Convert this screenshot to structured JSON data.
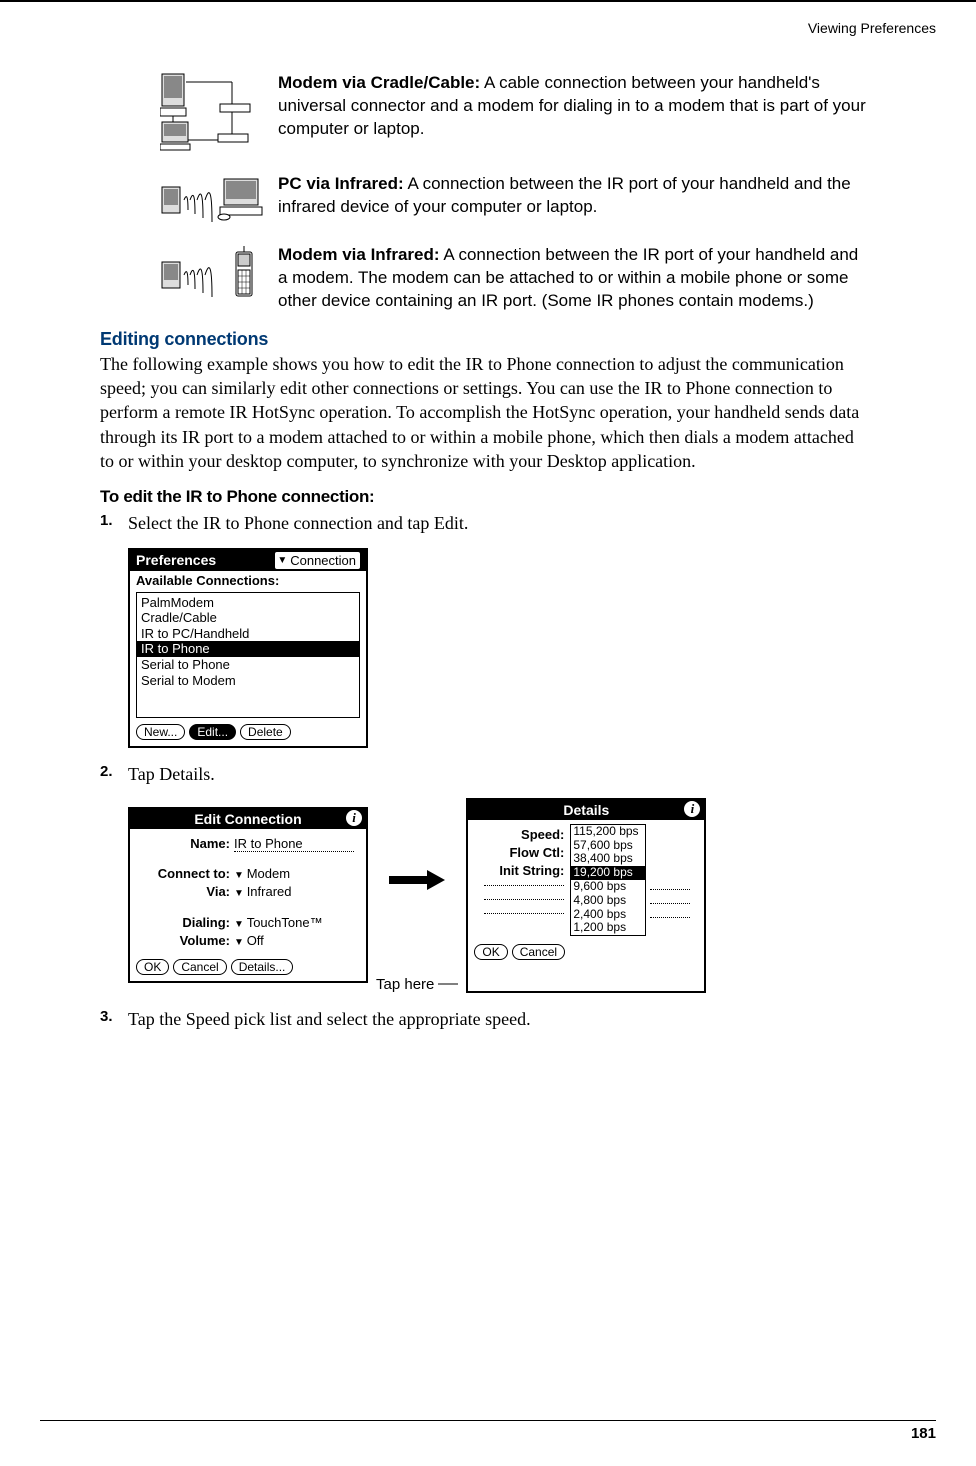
{
  "header": "Viewing Preferences",
  "page_number": "181",
  "defs": [
    {
      "title": " Modem via Cradle/Cable:",
      "text": " A cable connection between your handheld's universal connector and a modem for dialing in to a modem that is part of your computer or laptop."
    },
    {
      "title": "PC via Infrared:",
      "text": " A connection between the IR port of your handheld and the infrared device of your computer or laptop."
    },
    {
      "title": "Modem via Infrared:",
      "text": " A connection between the IR port of your handheld and a modem. The modem can be attached to or within a mobile phone or some other device containing an IR port. (Some IR phones contain modems.)"
    }
  ],
  "editing_heading": "Editing connections",
  "editing_body": "The following example shows you how to edit the IR to Phone connection to adjust the communication speed; you can similarly edit other connections or settings. You can use the IR to Phone connection to perform a remote IR HotSync operation. To accomplish the HotSync operation, your handheld sends data through its IR port to a modem attached to or within a mobile phone, which then dials a modem attached to or within your desktop computer, to synchronize with your Desktop application.",
  "procedure_heading": "To edit the IR to Phone connection:",
  "steps": [
    "Select the IR to Phone connection and tap Edit.",
    "Tap Details.",
    "Tap the Speed pick list and select the appropriate speed."
  ],
  "prefs_screen": {
    "title": "Preferences",
    "menu": "Connection",
    "label": "Available Connections:",
    "items": [
      "PalmModem",
      "Cradle/Cable",
      "IR to PC/Handheld",
      "IR to Phone",
      "Serial to Phone",
      "Serial to Modem"
    ],
    "buttons": [
      "New...",
      "Edit...",
      "Delete"
    ]
  },
  "edit_screen": {
    "title": "Edit Connection",
    "name_label": "Name:",
    "name_value": "IR to Phone",
    "connect_label": "Connect to:",
    "connect_value": "Modem",
    "via_label": "Via:",
    "via_value": "Infrared",
    "dialing_label": "Dialing:",
    "dialing_value": "TouchTone™",
    "volume_label": "Volume:",
    "volume_value": "Off",
    "buttons": [
      "OK",
      "Cancel",
      "Details..."
    ]
  },
  "details_screen": {
    "title": "Details",
    "speed_label": "Speed:",
    "flow_label": "Flow Ctl:",
    "init_label": "Init String:",
    "speeds": [
      "115,200 bps",
      "57,600 bps",
      "38,400 bps",
      "19,200 bps",
      "9,600 bps",
      "4,800 bps",
      "2,400 bps",
      "1,200 bps"
    ],
    "buttons": [
      "OK",
      "Cancel"
    ]
  },
  "callout_tap": "Tap here"
}
